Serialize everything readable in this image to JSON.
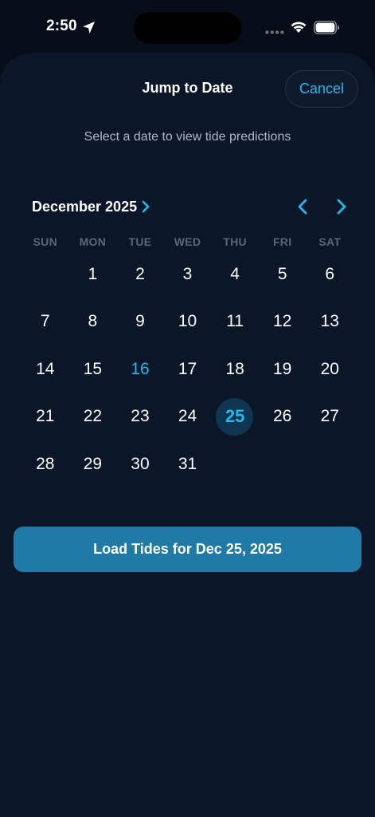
{
  "status_bar": {
    "time": "2:50"
  },
  "header": {
    "title": "Jump to Date",
    "cancel_label": "Cancel"
  },
  "subtitle": "Select a date to view tide predictions",
  "calendar": {
    "month_label": "December 2025",
    "weekdays": [
      "SUN",
      "MON",
      "TUE",
      "WED",
      "THU",
      "FRI",
      "SAT"
    ],
    "weeks": [
      [
        "",
        "1",
        "2",
        "3",
        "4",
        "5",
        "6"
      ],
      [
        "7",
        "8",
        "9",
        "10",
        "11",
        "12",
        "13"
      ],
      [
        "14",
        "15",
        "16",
        "17",
        "18",
        "19",
        "20"
      ],
      [
        "21",
        "22",
        "23",
        "24",
        "25",
        "26",
        "27"
      ],
      [
        "28",
        "29",
        "30",
        "31",
        "",
        "",
        ""
      ]
    ],
    "today": "16",
    "selected": "25"
  },
  "load_button_label": "Load Tides for Dec 25, 2025",
  "colors": {
    "accent": "#27b7ea",
    "button": "#1f7aa6",
    "background": "#0b1628"
  }
}
